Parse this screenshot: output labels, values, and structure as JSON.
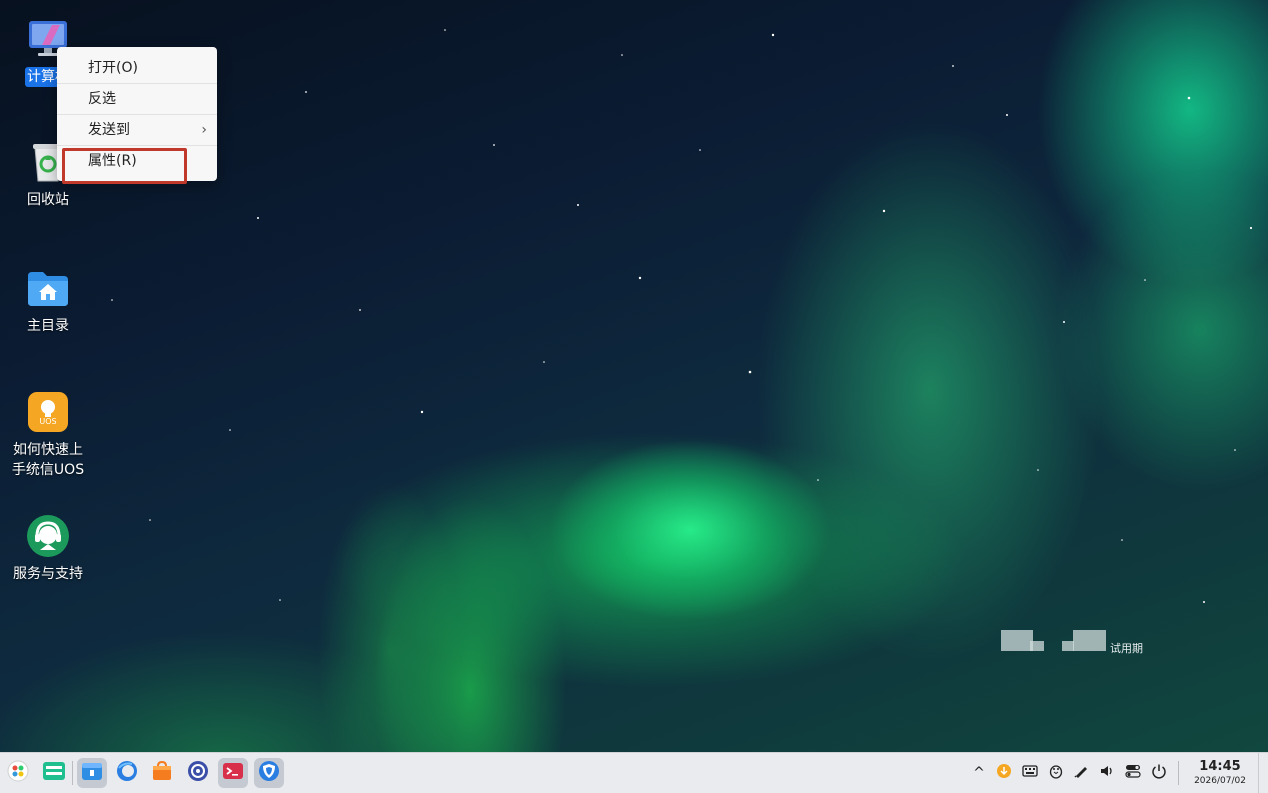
{
  "desktop": {
    "icons": [
      {
        "label": "计算机"
      },
      {
        "label": "回收站"
      },
      {
        "label": "主目录"
      },
      {
        "label": "如何快速上手统信UOS"
      },
      {
        "label": "服务与支持"
      }
    ],
    "uos_badge": "UOS"
  },
  "context_menu": {
    "items": [
      {
        "label": "打开(O)"
      },
      {
        "label": "反选"
      },
      {
        "label": "发送到",
        "submenu_arrow": "›"
      },
      {
        "label": "属性(R)"
      }
    ]
  },
  "watermark": {
    "text": "试用期"
  },
  "taskbar": {
    "apps": [
      {
        "icon": "launcher-icon"
      },
      {
        "icon": "multitask-view-icon"
      },
      {
        "icon": "file-manager-icon"
      },
      {
        "icon": "browser-icon"
      },
      {
        "icon": "app-store-icon"
      },
      {
        "icon": "control-center-icon"
      },
      {
        "icon": "terminal-icon"
      },
      {
        "icon": "security-center-icon"
      }
    ],
    "tray": {
      "expand_glyph": "^",
      "icons": [
        "update-icon",
        "keyboard-icon",
        "tux-icon",
        "pen-icon",
        "volume-icon",
        "toggle-icon",
        "power-icon"
      ]
    },
    "clock": {
      "time": "14:45",
      "date": "2026/07/02"
    }
  }
}
